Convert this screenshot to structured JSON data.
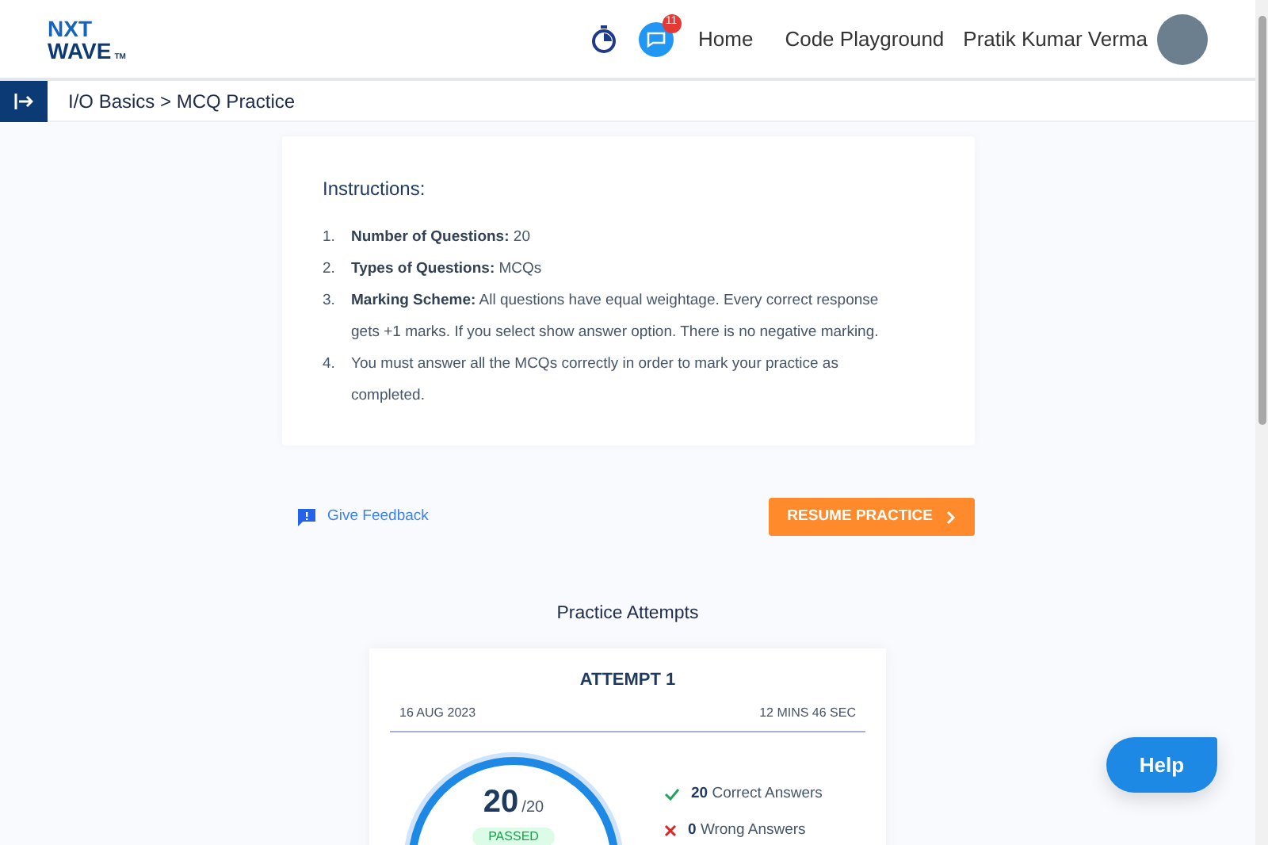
{
  "header": {
    "logo": {
      "line1": "NXT",
      "line2": "WAVE",
      "tm": "TM"
    },
    "notification_count": "11",
    "nav": [
      "Home",
      "Code Playground"
    ],
    "user_name": "Pratik Kumar Verma"
  },
  "breadcrumb": "I/O Basics > MCQ Practice",
  "instructions": {
    "title": "Instructions:",
    "items": [
      {
        "number": "1.",
        "text": "**Number of Questions:** 20"
      },
      {
        "number": "2.",
        "text": "**Types of Questions:**  MCQs"
      },
      {
        "number": "3.",
        "text": "**Marking Scheme:**  All questions have equal weightage. Every correct response gets +1 marks. If you select show answer option. There is no negative marking."
      },
      {
        "number": "4.",
        "text": "You must answer all the MCQs correctly in order to mark your practice as completed."
      }
    ]
  },
  "feedback_link": "Give Feedback",
  "resume_button": "RESUME PRACTICE",
  "attempts": {
    "title": "Practice Attempts",
    "items": [
      {
        "title": "ATTEMPT 1",
        "date": "16 AUG 2023",
        "duration": "12 MINS 46 SEC",
        "score": "20",
        "total": "/20",
        "status": "PASSED",
        "stats": [
          {
            "kind": "correct",
            "count": "20",
            "label": "Correct Answers"
          },
          {
            "kind": "wrong",
            "count": "0",
            "label": "Wrong Answers"
          }
        ]
      }
    ]
  },
  "help_button": "Help"
}
